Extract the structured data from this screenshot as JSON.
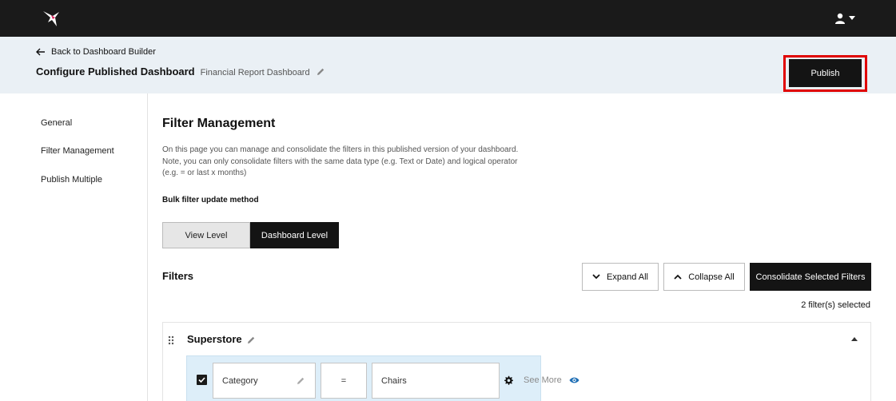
{
  "topbar": {
    "logo_icon": "hummingbird-logo-icon",
    "user_icon": "user-icon"
  },
  "header": {
    "back_label": "Back to Dashboard Builder",
    "title": "Configure Published Dashboard",
    "subtitle": "Financial Report Dashboard",
    "publish_label": "Publish"
  },
  "sidebar": {
    "items": [
      {
        "label": "General"
      },
      {
        "label": "Filter Management"
      },
      {
        "label": "Publish Multiple"
      }
    ]
  },
  "main": {
    "heading": "Filter Management",
    "description": "On this page you can manage and consolidate the filters in this published version of your dashboard. Note, you can only consolidate filters with the same data type (e.g. Text or Date) and logical operator (e.g. = or last x months)",
    "bulk_label": "Bulk filter update method",
    "segments": [
      {
        "label": "View Level",
        "active": false
      },
      {
        "label": "Dashboard Level",
        "active": true
      }
    ],
    "filters_heading": "Filters",
    "expand_label": "Expand All",
    "collapse_label": "Collapse All",
    "consolidate_label": "Consolidate Selected Filters",
    "selected_count": "2 filter(s) selected",
    "group": {
      "title": "Superstore",
      "filter": {
        "checked": true,
        "field": "Category",
        "operator": "=",
        "value": "Chairs",
        "see_more": "See More"
      }
    }
  },
  "colors": {
    "topbar": "#1a1a1a",
    "header_bg": "#eaf0f5",
    "highlight": "#e00000",
    "filter_row_bg": "#ddeef9",
    "eye_icon": "#1f6fb5"
  }
}
